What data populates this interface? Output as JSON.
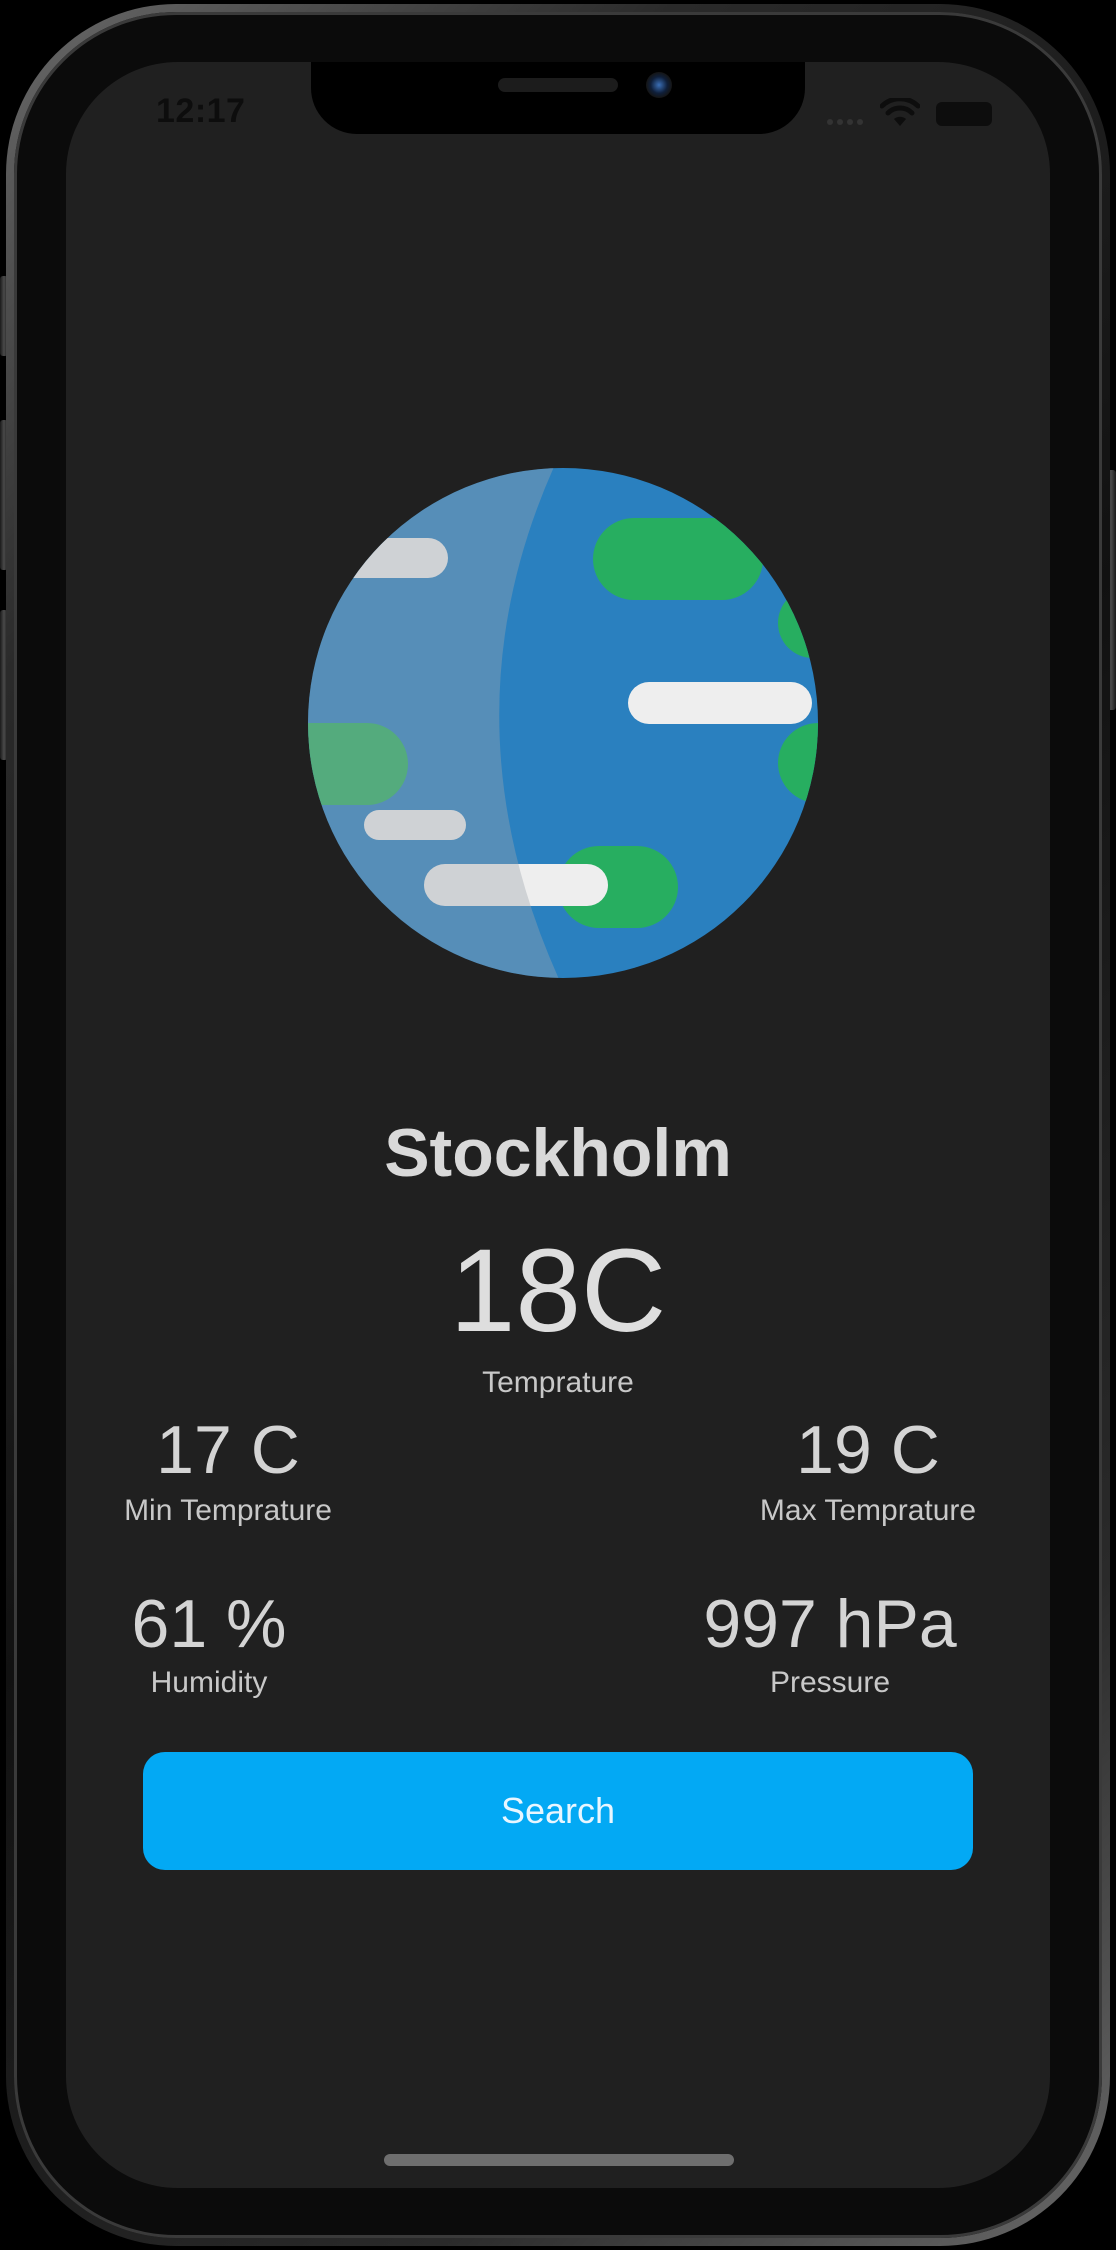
{
  "status_bar": {
    "time": "12:17"
  },
  "weather": {
    "city": "Stockholm",
    "temperature": "18C",
    "temperature_label": "Temprature",
    "min_temperature": "17 C",
    "min_temperature_label": "Min Temprature",
    "max_temperature": "19 C",
    "max_temperature_label": "Max Temprature",
    "humidity": "61 %",
    "humidity_label": "Humidity",
    "pressure": "997 hPa",
    "pressure_label": "Pressure"
  },
  "actions": {
    "search_label": "Search"
  },
  "colors": {
    "background": "#202020",
    "accent": "#03a9f4",
    "globe_ocean": "#2a80bf",
    "globe_land": "#27ae60",
    "cloud": "#eeeeee"
  },
  "icons": {
    "weather_illustration": "earth-globe-icon",
    "wifi": "wifi-icon",
    "battery": "battery-icon"
  }
}
